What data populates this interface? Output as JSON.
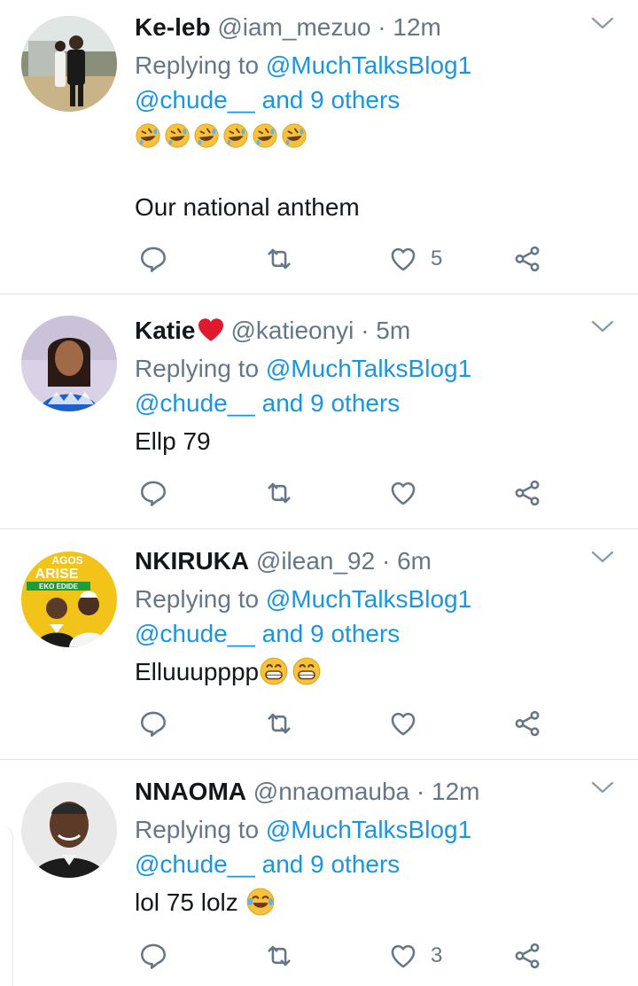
{
  "tweets": [
    {
      "name": "Ke-leb",
      "handle": "@iam_mezuo",
      "dot": "·",
      "time": "12m",
      "reply_prefix": "Replying to",
      "reply_to": "@MuchTalksBlog1",
      "reply_others": "@chude__ and 9 others",
      "emoji_line": "🤣🤣🤣🤣🤣🤣",
      "text": "Our national anthem",
      "likes": "5"
    },
    {
      "name": "Katie",
      "handle": "@katieonyi",
      "dot": "·",
      "time": "5m",
      "reply_prefix": "Replying to",
      "reply_to": "@MuchTalksBlog1",
      "reply_others": "@chude__ and 9 others",
      "text": "Ellp 79",
      "likes": ""
    },
    {
      "name": "NKIRUKA",
      "handle": "@ilean_92",
      "dot": "·",
      "time": "6m",
      "reply_prefix": "Replying to",
      "reply_to": "@MuchTalksBlog1",
      "reply_others": "@chude__ and 9 others",
      "text": "Elluuupppp",
      "likes": "",
      "avatar_text": {
        "top": "AGOS",
        "mid": "ARISE",
        "bottom": "EKO EDIDE"
      }
    },
    {
      "name": "NNAOMA",
      "handle": "@nnaomauba",
      "dot": "·",
      "time": "12m",
      "reply_prefix": "Replying to",
      "reply_to": "@MuchTalksBlog1",
      "reply_others": "@chude__ and 9 others",
      "text": "lol 75 lolz",
      "likes": "3"
    }
  ],
  "colors": {
    "link": "#1b95e0",
    "muted": "#657786",
    "text": "#14171a",
    "divider": "#dde1e5"
  },
  "icons": [
    "reply-icon",
    "retweet-icon",
    "like-icon",
    "share-icon",
    "chevron-down-icon"
  ]
}
